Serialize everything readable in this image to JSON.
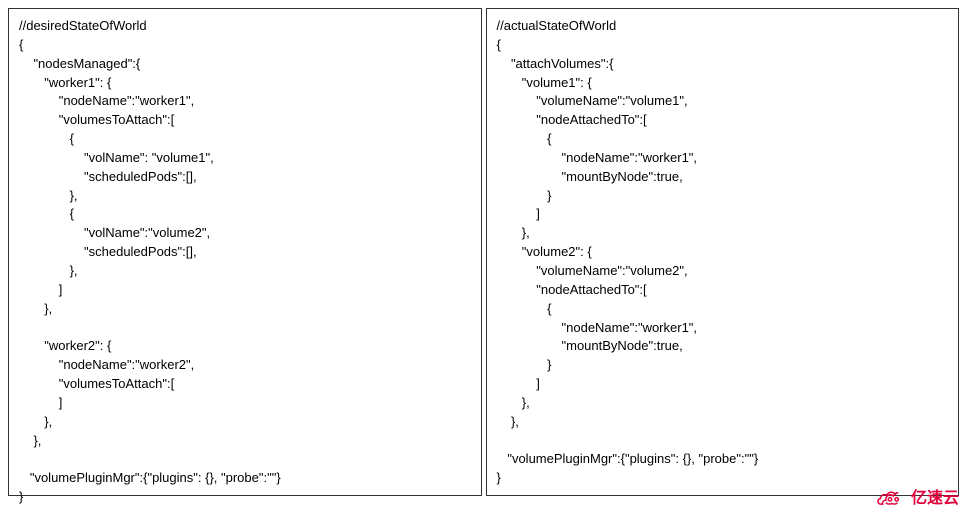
{
  "left": {
    "lines": [
      "//desiredStateOfWorld",
      "{",
      "    \"nodesManaged\":{",
      "       \"worker1\": {",
      "           \"nodeName\":\"worker1\",",
      "           \"volumesToAttach\":[",
      "              {",
      "                  \"volName\": \"volume1\",",
      "                  \"scheduledPods\":[],",
      "              },",
      "              {",
      "                  \"volName\":\"volume2\",",
      "                  \"scheduledPods\":[],",
      "              },",
      "           ]",
      "       },",
      "",
      "       \"worker2\": {",
      "           \"nodeName\":\"worker2\",",
      "           \"volumesToAttach\":[",
      "           ]",
      "       },",
      "    },",
      "",
      "   \"volumePluginMgr\":{\"plugins\": {}, \"probe\":\"\"}",
      "}"
    ]
  },
  "right": {
    "lines": [
      "//actualStateOfWorld",
      "{",
      "    \"attachVolumes\":{",
      "       \"volume1\": {",
      "           \"volumeName\":\"volume1\",",
      "           \"nodeAttachedTo\":[",
      "              {",
      "                  \"nodeName\":\"worker1\",",
      "                  \"mountByNode\":true,",
      "              }",
      "           ]",
      "       },",
      "       \"volume2\": {",
      "           \"volumeName\":\"volume2\",",
      "           \"nodeAttachedTo\":[",
      "              {",
      "                  \"nodeName\":\"worker1\",",
      "                  \"mountByNode\":true,",
      "              }",
      "           ]",
      "       },",
      "    },",
      "",
      "   \"volumePluginMgr\":{\"plugins\": {}, \"probe\":\"\"}",
      "}"
    ]
  },
  "logo_text": "亿速云"
}
